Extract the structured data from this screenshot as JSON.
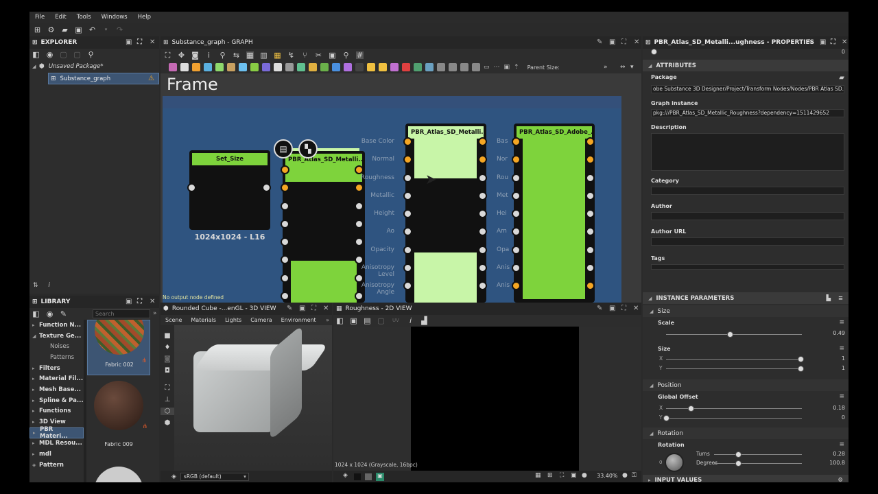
{
  "menu": [
    "File",
    "Edit",
    "Tools",
    "Windows",
    "Help"
  ],
  "explorer": {
    "title": "EXPLORER",
    "package": "Unsaved Package*",
    "graph": "Substance_graph"
  },
  "graph": {
    "title": "Substance_graph - GRAPH",
    "parent_size_label": "Parent Size:",
    "frame_title": "Frame",
    "status": "No output node defined",
    "set_size_node": {
      "title": "Set_Size",
      "label": "1024x1024 - L16"
    },
    "node2_title": "PBR_Atlas_SD_Metalli...",
    "node3_title": "PBR_Atlas_SD_Metalli...",
    "node4_title": "PBR_Atlas_SD_Adobe_...",
    "ports": [
      "Base Color",
      "Normal",
      "Roughness",
      "Metallic",
      "Height",
      "Ao",
      "Opacity",
      "Anisotropy Level",
      "Anisotropy Angle"
    ],
    "ports_short": [
      "Bas",
      "Nor",
      "Rou",
      "Met",
      "Hei",
      "Am",
      "Opa",
      "Anis",
      "Anis"
    ]
  },
  "properties": {
    "title": "PBR_Atlas_SD_Metalli...ughness - PROPERTIES",
    "top_value": "0",
    "attributes": {
      "header": "ATTRIBUTES",
      "package_label": "Package",
      "package_value": "obe Substance 3D Designer/Project/Transform Nodes/Nodes/PBR Atlas SD.sbsar",
      "graph_instance_label": "Graph instance",
      "graph_instance_value": "pkg:///PBR_Atlas_SD_Metallic_Roughness?dependency=1511429652",
      "description_label": "Description",
      "category_label": "Category",
      "author_label": "Author",
      "author_url_label": "Author URL",
      "tags_label": "Tags"
    },
    "instance_parameters": {
      "header": "INSTANCE PARAMETERS",
      "size_group": "Size",
      "scale_label": "Scale",
      "scale_value": "0.49",
      "scale_fraction": 0.49,
      "size_label": "Size",
      "size_x_axis": "X",
      "size_x_value": "1",
      "size_y_axis": "Y",
      "size_y_value": "1",
      "position_group": "Position",
      "global_offset_label": "Global Offset",
      "offset_x_axis": "X",
      "offset_x_value": "0.18",
      "offset_y_axis": "Y",
      "offset_y_value": "0",
      "rotation_group": "Rotation",
      "rotation_label": "Rotation",
      "dial_value": "0",
      "turns_label": "Turns",
      "turns_value": "0.28",
      "degrees_label": "Degrees",
      "degrees_value": "100.8"
    },
    "input_values_header": "INPUT VALUES"
  },
  "library": {
    "title": "LIBRARY",
    "search_placeholder": "Search",
    "items": [
      {
        "label": "Function N...",
        "expanded": false
      },
      {
        "label": "Texture Ge...",
        "expanded": true
      },
      {
        "label": "Noises",
        "child": true
      },
      {
        "label": "Patterns",
        "child": true
      },
      {
        "label": "Filters",
        "expanded": false
      },
      {
        "label": "Material Fil...",
        "expanded": false
      },
      {
        "label": "Mesh Base...",
        "expanded": false
      },
      {
        "label": "Spline & Pa...",
        "expanded": false
      },
      {
        "label": "Functions",
        "expanded": false
      },
      {
        "label": "3D View",
        "expanded": false
      },
      {
        "label": "PBR Materi...",
        "expanded": false
      },
      {
        "label": "MDL Resou...",
        "expanded": false
      },
      {
        "label": "mdl",
        "expanded": false
      },
      {
        "label": "Pattern",
        "expanded": false
      }
    ],
    "thumbs": [
      "Fabric 002",
      "Fabric 009"
    ]
  },
  "view3d": {
    "title": "Rounded Cube -...enGL - 3D VIEW",
    "tabs": [
      "Scene",
      "Materials",
      "Lights",
      "Camera",
      "Environment"
    ],
    "colorspace": "sRGB (default)"
  },
  "view2d": {
    "title": "Roughness - 2D VIEW",
    "info": "1024 x 1024 (Grayscale, 16bpc)",
    "zoom": "33.40%",
    "uv_label": "UV"
  },
  "colors": {
    "node_green": "#7ed33c",
    "light_green": "#c8f5a8",
    "frame_blue": "#2f5480",
    "port_orange": "#f5a623"
  }
}
